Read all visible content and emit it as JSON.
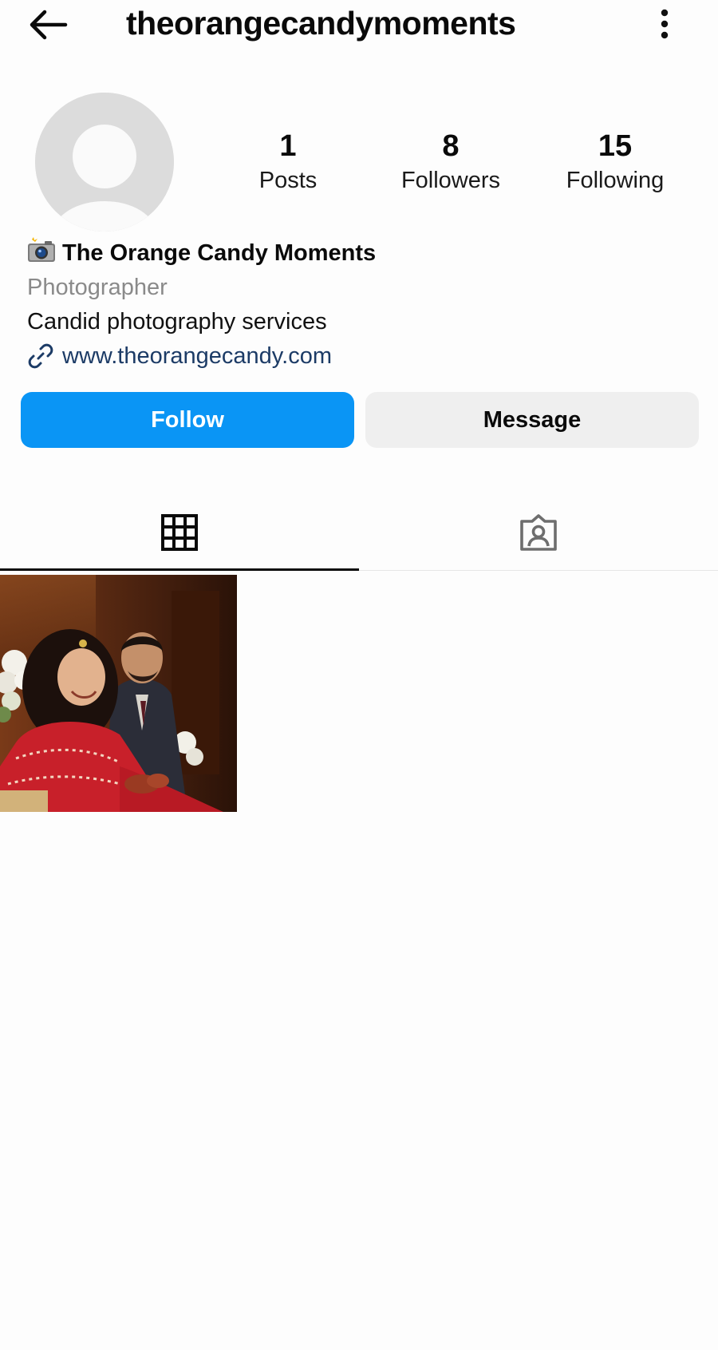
{
  "header": {
    "username": "theorangecandymoments",
    "back_icon": "arrow-left-icon",
    "more_icon": "more-vertical-icon"
  },
  "profile": {
    "avatar_icon": "default-avatar-icon",
    "stats": [
      {
        "value": "1",
        "label": "Posts"
      },
      {
        "value": "8",
        "label": "Followers"
      },
      {
        "value": "15",
        "label": "Following"
      }
    ],
    "display_name": "The Orange Candy Moments",
    "name_emoji": "camera-flash-icon",
    "category": "Photographer",
    "bio": "Candid photography services",
    "link": "www.theorangecandy.com",
    "link_icon": "link-icon"
  },
  "actions": {
    "follow_label": "Follow",
    "message_label": "Message"
  },
  "tabs": [
    {
      "icon": "grid-icon",
      "active": true
    },
    {
      "icon": "tagged-user-icon",
      "active": false
    }
  ],
  "posts": [
    {
      "alt": "wedding-couple-photo"
    }
  ],
  "colors": {
    "follow_button": "#0a95f5",
    "message_button": "#efefef",
    "link_text": "#1c3b66",
    "category_text": "#8a8a8a",
    "avatar_bg": "#dedede"
  }
}
